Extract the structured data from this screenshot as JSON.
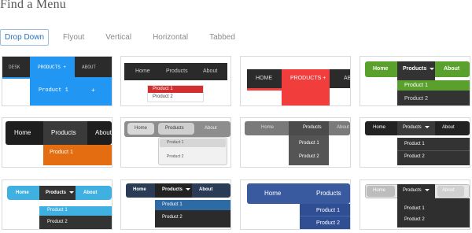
{
  "page": {
    "title": "Find a Menu"
  },
  "tabs": [
    {
      "label": "Drop Down"
    },
    {
      "label": "Flyout"
    },
    {
      "label": "Vertical"
    },
    {
      "label": "Horizontal"
    },
    {
      "label": "Tabbed"
    }
  ],
  "previews": {
    "p1": {
      "home": "DESK",
      "products": "PRODUCTS +",
      "about": "ABOUT",
      "item1": "Product 1",
      "plus": "+"
    },
    "p2": {
      "home": "Home",
      "products": "Products",
      "about": "About",
      "item1": "Product 1",
      "item2": "Product 2"
    },
    "p3": {
      "home": "HOME",
      "products": "PRODUCTS +",
      "about": "AB"
    },
    "p4": {
      "home": "Home",
      "products": "Products",
      "about": "About",
      "item1": "Product 1",
      "item2": "Product 2"
    },
    "p5": {
      "home": "Home",
      "products": "Products",
      "about": "About",
      "item1": "Product 1"
    },
    "p6": {
      "home": "Home",
      "products": "Products",
      "about": "About",
      "item1": "Product 1",
      "item2": "Product 2"
    },
    "p7": {
      "home": "Home",
      "products": "Products",
      "about": "About",
      "item1": "Product 1",
      "item2": "Product 2"
    },
    "p8": {
      "home": "Home",
      "products": "Products",
      "about": "About",
      "item1": "Product 1",
      "item2": "Product 2"
    },
    "p9": {
      "home": "Home",
      "products": "Products",
      "about": "About",
      "item1": "Product 1",
      "item2": "Product 2"
    },
    "p10": {
      "home": "Home",
      "products": "Products",
      "about": "About",
      "item1": "Product 1",
      "item2": "Product 2"
    },
    "p11": {
      "home": "Home",
      "products": "Products",
      "item1": "Product 1",
      "item2": "Product 2"
    },
    "p12": {
      "home": "Home",
      "products": "Products",
      "about": "About",
      "item1": "Product 1",
      "item2": "Product 2"
    }
  }
}
